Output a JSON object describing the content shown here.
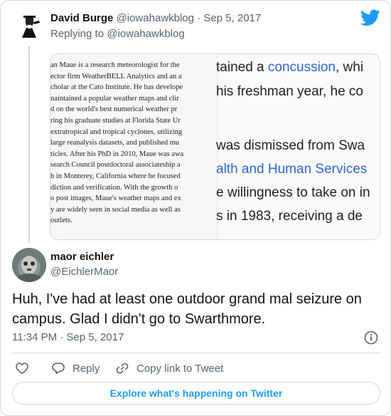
{
  "parent_tweet": {
    "author_name": "David Burge",
    "author_handle": "@iowahawkblog",
    "separator": "·",
    "date": "Sep 5, 2017",
    "replying_prefix": "Replying to",
    "replying_handle": "@iowahawkblog",
    "media": {
      "left_lines": [
        "an Maue is a research meteorologist for the",
        "ector firm WeatherBELL Analytics and an a",
        "cholar at the Cato Institute. He has develope",
        "naintained a popular weather maps and clir",
        "d on the world's best numerical weather pr",
        "ring his graduate studies at Florida State Ur",
        "extratropical and tropical cyclones, utilizing",
        "large reanalysis datasets, and published mu",
        "ticles. After his PhD in 2010, Maue was awa",
        "search Council postdoctoral associateship a",
        "b in Monterey, California where he focused",
        "diction and verification. With the growth o",
        "o post images, Maue's weather maps and ex",
        "y are widely seen in social media as well as",
        "outlets."
      ],
      "right_line1_a": "tained a ",
      "right_line1_link": "concussion",
      "right_line1_b": ", whi",
      "right_line2": " his freshman year, he co",
      "right_line3": "was dismissed from Swa",
      "right_line4": "alth and Human Services",
      "right_line5": "e willingness to take on in",
      "right_line6": "s in 1983, receiving a de"
    }
  },
  "reply_tweet": {
    "author_name": "maor eichler",
    "author_handle": "@EichlerMaor",
    "text": "Huh, I've had at least one outdoor grand mal seizure on campus. Glad I didn't go to Swarthmore.",
    "time": "11:34 PM · Sep 5, 2017"
  },
  "actions": {
    "reply_label": "Reply",
    "copy_label": "Copy link to Tweet"
  },
  "explore_label": "Explore what's happening on Twitter",
  "colors": {
    "accent": "#1d9bf0",
    "secondary_text": "#536471",
    "border": "#cfd9de"
  }
}
